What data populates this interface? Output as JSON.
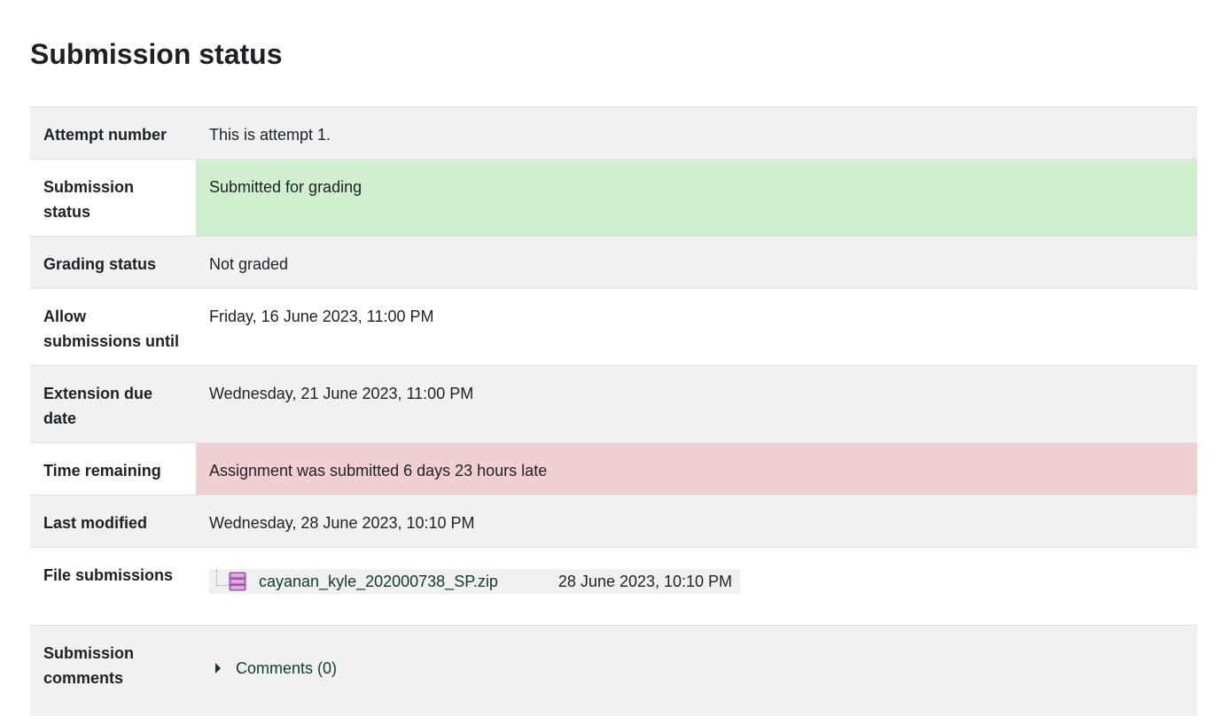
{
  "heading": "Submission status",
  "rows": [
    {
      "label": "Attempt number",
      "value": "This is attempt 1."
    },
    {
      "label": "Submission status",
      "value": "Submitted for grading"
    },
    {
      "label": "Grading status",
      "value": "Not graded"
    },
    {
      "label": "Allow submissions until",
      "value": "Friday, 16 June 2023, 11:00 PM"
    },
    {
      "label": "Extension due date",
      "value": "Wednesday, 21 June 2023, 11:00 PM"
    },
    {
      "label": "Time remaining",
      "value": "Assignment was submitted 6 days 23 hours late"
    },
    {
      "label": "Last modified",
      "value": "Wednesday, 28 June 2023, 10:10 PM"
    },
    {
      "label": "File submissions",
      "file_name": "cayanan_kyle_202000738_SP.zip",
      "file_date": "28 June 2023, 10:10 PM",
      "file_icon": "zip-archive-icon"
    },
    {
      "label": "Submission comments",
      "comments_link": "Comments (0)",
      "comments_icon": "caret-right-icon"
    }
  ],
  "colors": {
    "submitted_bg": "#cfefcf",
    "late_bg": "#efcfd1",
    "link": "#0f3d26",
    "row_alt": "#f1f1f1"
  }
}
